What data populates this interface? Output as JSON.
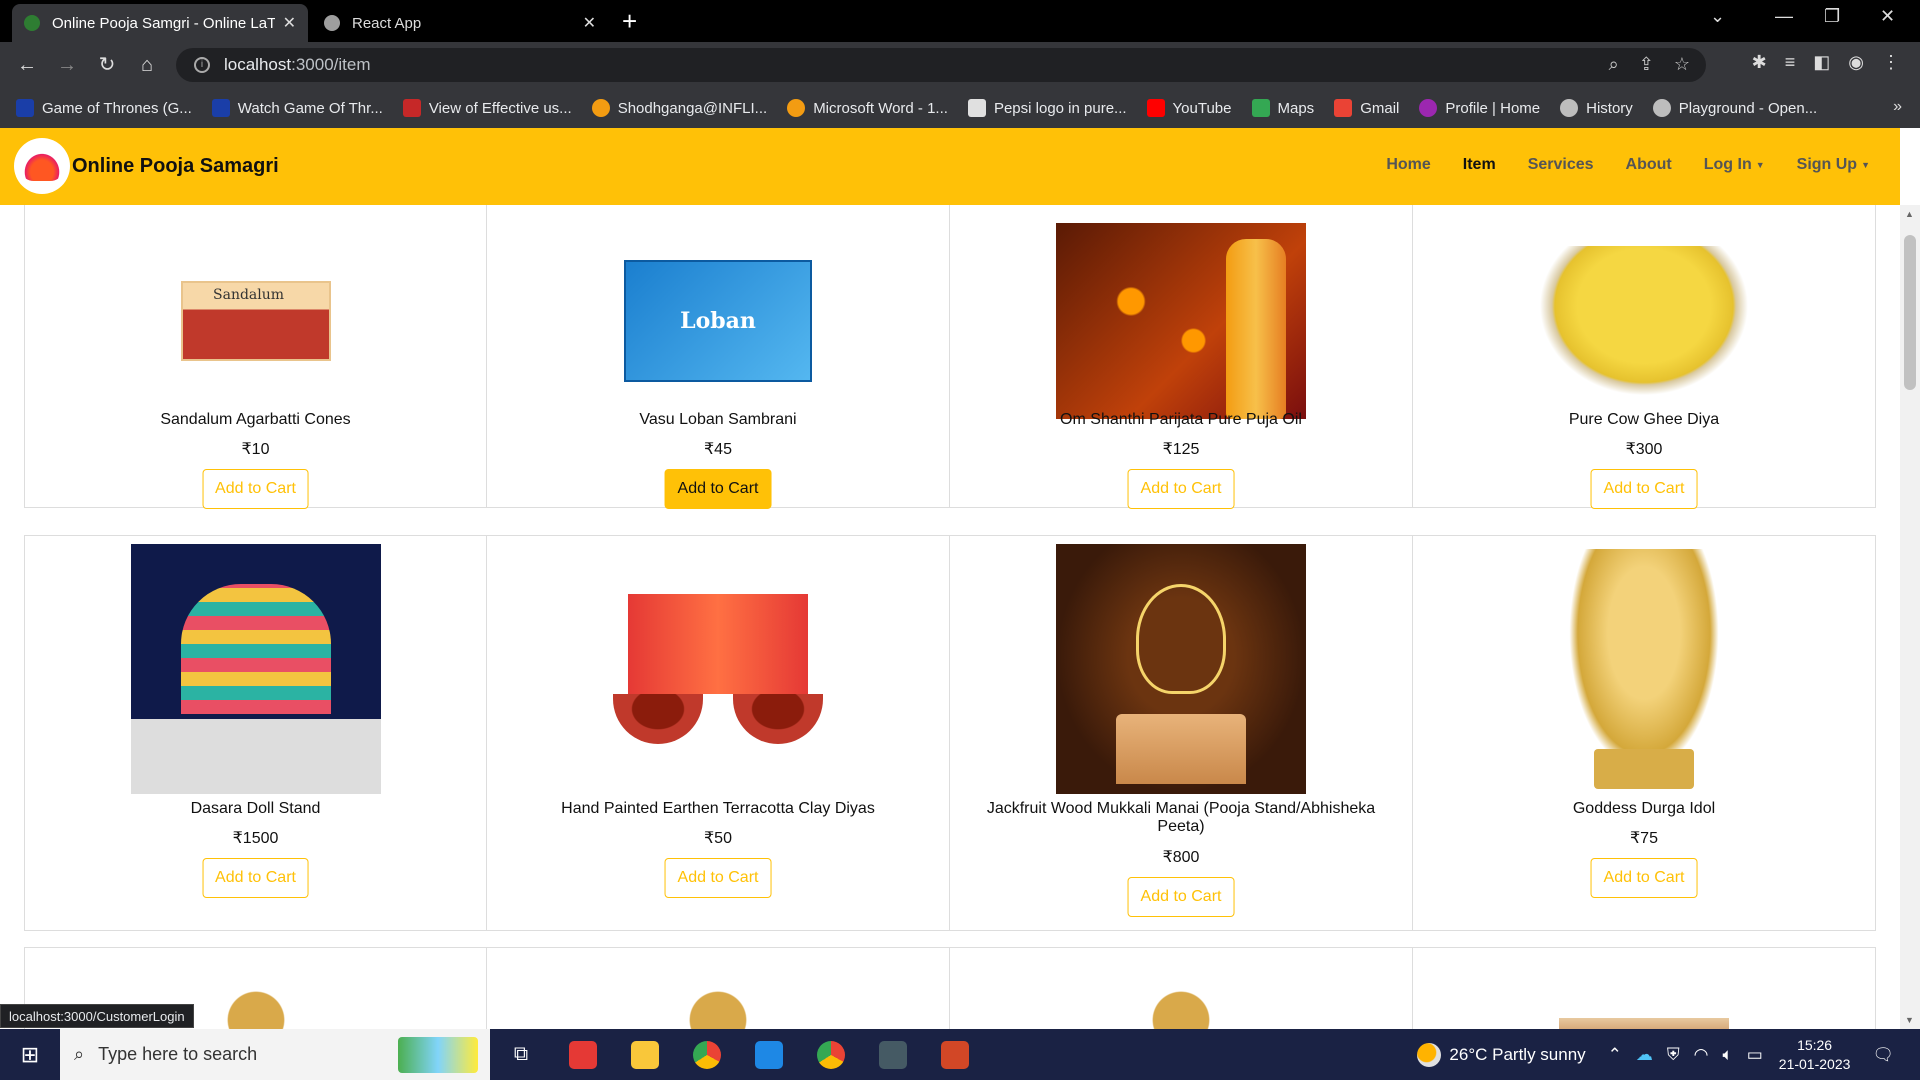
{
  "browser": {
    "tabs": [
      {
        "title": "Online Pooja Samgri - Online LaT",
        "active": true
      },
      {
        "title": "React App",
        "active": false
      }
    ],
    "url_host": "localhost",
    "url_rest": ":3000/item",
    "bookmarks": [
      {
        "label": "Game of Thrones (G...",
        "icon": "bh-icon",
        "color": "#1a3ea8"
      },
      {
        "label": "Watch Game Of Thr...",
        "icon": "bh-icon",
        "color": "#1a3ea8"
      },
      {
        "label": "View of Effective us...",
        "icon": "fm-icon",
        "color": "#c62828"
      },
      {
        "label": "Shodhganga@INFLI...",
        "icon": "shodhganga-icon",
        "color": "#f39c12"
      },
      {
        "label": "Microsoft Word - 1...",
        "icon": "shodhganga-icon",
        "color": "#f39c12"
      },
      {
        "label": "Pepsi logo in pure...",
        "icon": "pepsi-icon",
        "color": "#e0e0e0"
      },
      {
        "label": "YouTube",
        "icon": "youtube-icon",
        "color": "#ff0000"
      },
      {
        "label": "Maps",
        "icon": "maps-icon",
        "color": "#34a853"
      },
      {
        "label": "Gmail",
        "icon": "gmail-icon",
        "color": "#ea4335"
      },
      {
        "label": "Profile | Home",
        "icon": "profile-icon",
        "color": "#9c27b0"
      },
      {
        "label": "History",
        "icon": "history-icon",
        "color": "#bdbdbd"
      },
      {
        "label": "Playground - Open...",
        "icon": "openai-icon",
        "color": "#bdbdbd"
      }
    ],
    "status_url": "localhost:3000/CustomerLogin"
  },
  "site": {
    "brand": "Online Pooja Samagri",
    "nav": {
      "home": "Home",
      "item": "Item",
      "services": "Services",
      "about": "About",
      "login": "Log In",
      "signup": "Sign Up"
    }
  },
  "products": [
    {
      "name": "Sandalum Agarbatti Cones",
      "price": "₹10",
      "button": "Add to Cart",
      "image": "sandalum",
      "image_text": "Sandalum",
      "hovered": false
    },
    {
      "name": "Vasu Loban Sambrani",
      "price": "₹45",
      "button": "Add to Cart",
      "image": "loban",
      "image_text": "Loban",
      "hovered": true
    },
    {
      "name": "Om Shanthi Parijata Pure Puja Oil",
      "price": "₹125",
      "button": "Add to Cart",
      "image": "oil",
      "hovered": false
    },
    {
      "name": "Pure Cow Ghee Diya",
      "price": "₹300",
      "button": "Add to Cart",
      "image": "ghee",
      "hovered": false
    },
    {
      "name": "Dasara Doll Stand",
      "price": "₹1500",
      "button": "Add to Cart",
      "image": "doll",
      "hovered": false
    },
    {
      "name": "Hand Painted Earthen Terracotta Clay Diyas",
      "price": "₹50",
      "button": "Add to Cart",
      "image": "diya",
      "hovered": false
    },
    {
      "name": "Jackfruit Wood Mukkali Manai (Pooja Stand/Abhisheka Peeta)",
      "price": "₹800",
      "button": "Add to Cart",
      "image": "stand",
      "hovered": false
    },
    {
      "name": "Goddess Durga Idol",
      "price": "₹75",
      "button": "Add to Cart",
      "image": "durga",
      "hovered": false
    }
  ],
  "taskbar": {
    "search_placeholder": "Type here to search",
    "weather": "26°C  Partly sunny",
    "time": "15:26",
    "date": "21-01-2023"
  },
  "colors": {
    "accent": "#ffc107",
    "browser_dark": "#35363a"
  }
}
